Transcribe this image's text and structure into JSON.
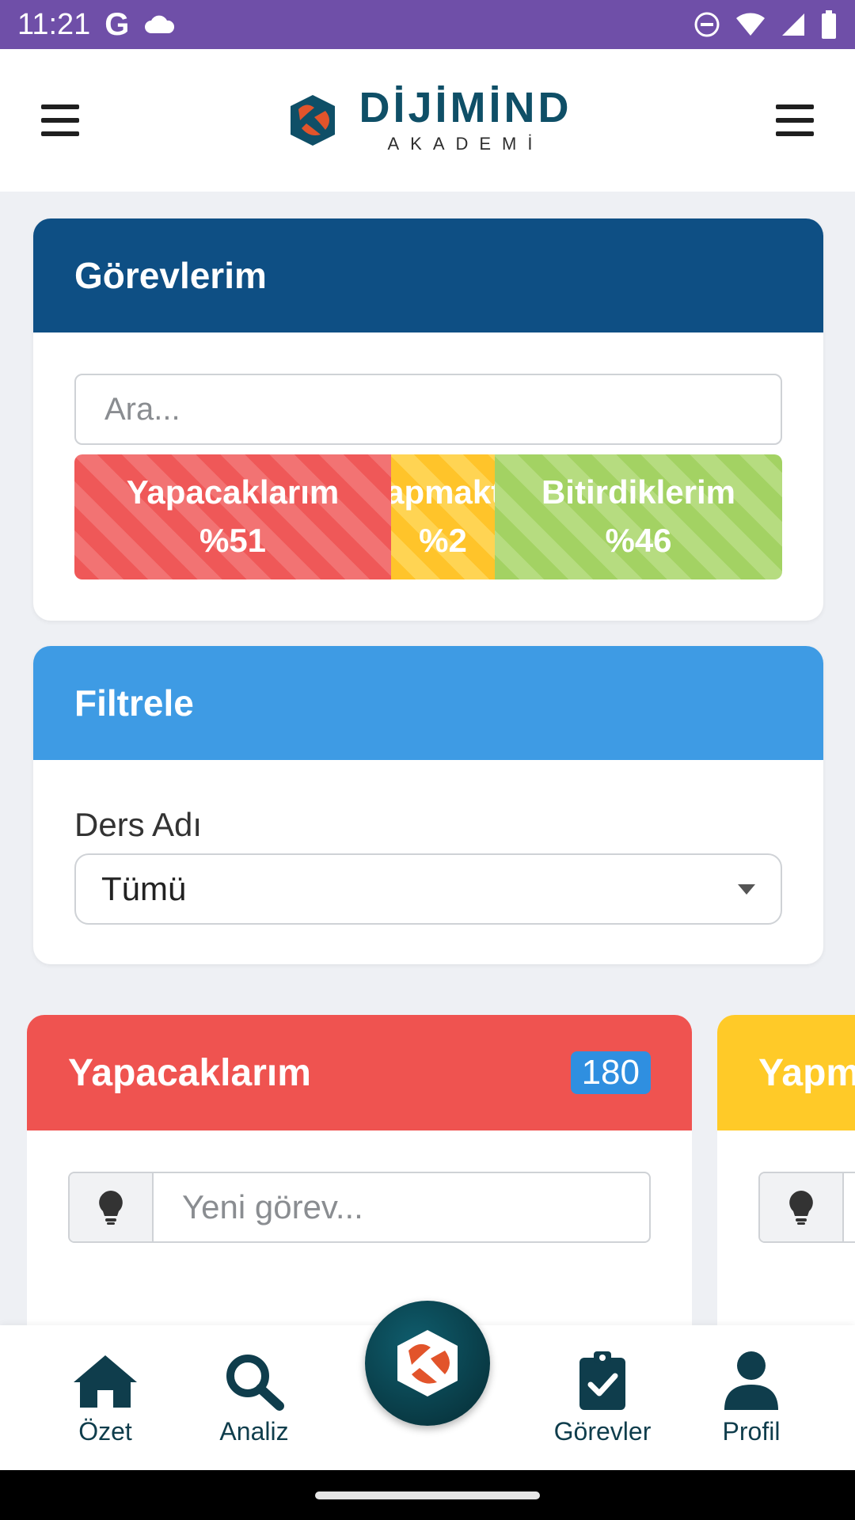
{
  "status_bar": {
    "time": "11:21",
    "g_label": "G"
  },
  "brand": {
    "name": "DİJİMİND",
    "subtitle": "AKADEMİ"
  },
  "tasks_card": {
    "title": "Görevlerim",
    "search_placeholder": "Ara...",
    "segments": [
      {
        "label": "Yapacaklarım",
        "percent": "%51",
        "value": 51,
        "color": "#ef5858"
      },
      {
        "label": "Yapmakta",
        "percent": "%2",
        "value": 2,
        "color": "#ffc42a"
      },
      {
        "label": "Bitirdiklerim",
        "percent": "%46",
        "value": 46,
        "color": "#a3d263"
      }
    ]
  },
  "filter_card": {
    "title": "Filtrele",
    "field_label": "Ders Adı",
    "selected": "Tümü"
  },
  "columns": [
    {
      "title": "Yapacaklarım",
      "count": "180",
      "new_task_placeholder": "Yeni görev...",
      "color": "#ef5350"
    },
    {
      "title": "Yapmakta",
      "color": "#ffca28"
    }
  ],
  "bottom_nav": {
    "items": [
      {
        "label": "Özet",
        "icon": "home-icon"
      },
      {
        "label": "Analiz",
        "icon": "search-icon"
      },
      {
        "label": "Görevler",
        "icon": "clipboard-check-icon"
      },
      {
        "label": "Profil",
        "icon": "user-icon"
      }
    ]
  }
}
